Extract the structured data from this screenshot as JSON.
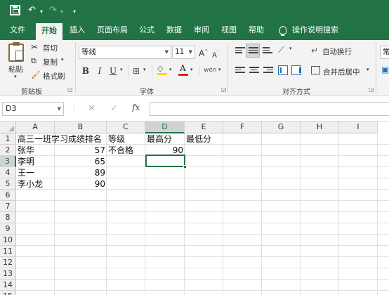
{
  "quick_access": {
    "undo_glyph": "↶",
    "redo_glyph": "↷",
    "more_glyph": "▾"
  },
  "tabs": [
    "文件",
    "开始",
    "插入",
    "页面布局",
    "公式",
    "数据",
    "审阅",
    "视图",
    "帮助"
  ],
  "tell_me": "操作说明搜索",
  "clipboard": {
    "paste": "粘贴",
    "cut": "剪切",
    "copy": "复制",
    "format_painter": "格式刷",
    "group": "剪贴板"
  },
  "font": {
    "name": "等线",
    "size": "11",
    "grow": "A",
    "shrink": "A",
    "bold": "B",
    "italic": "I",
    "underline": "U",
    "group": "字体",
    "phonetic": "wén"
  },
  "alignment": {
    "wrap": "自动换行",
    "merge": "合并后居中",
    "group": "对齐方式"
  },
  "number": {
    "format": "常"
  },
  "formula_bar": {
    "name_box": "D3",
    "fx": "fx",
    "cancel": "✕",
    "enter": "✓",
    "content": ""
  },
  "columns": [
    "A",
    "B",
    "C",
    "D",
    "E",
    "F",
    "G",
    "H",
    "I"
  ],
  "rows": [
    "1",
    "2",
    "3",
    "4",
    "5",
    "6",
    "7",
    "8",
    "9",
    "10",
    "11",
    "12",
    "13",
    "14",
    "15"
  ],
  "cells": {
    "A1": "高三一班学习成绩排名",
    "C1": "等级",
    "D1": "最高分",
    "E1": "最低分",
    "A2": "张华",
    "B2": "57",
    "C2": "不合格",
    "D2": "90",
    "A3": "李明",
    "B3": "65",
    "A4": "王一",
    "B4": "89",
    "A5": "李小龙",
    "B5": "90"
  },
  "colors": {
    "accent": "#217346",
    "font_color_bar": "#e02020",
    "fill_color_bar": "#ffd700"
  }
}
